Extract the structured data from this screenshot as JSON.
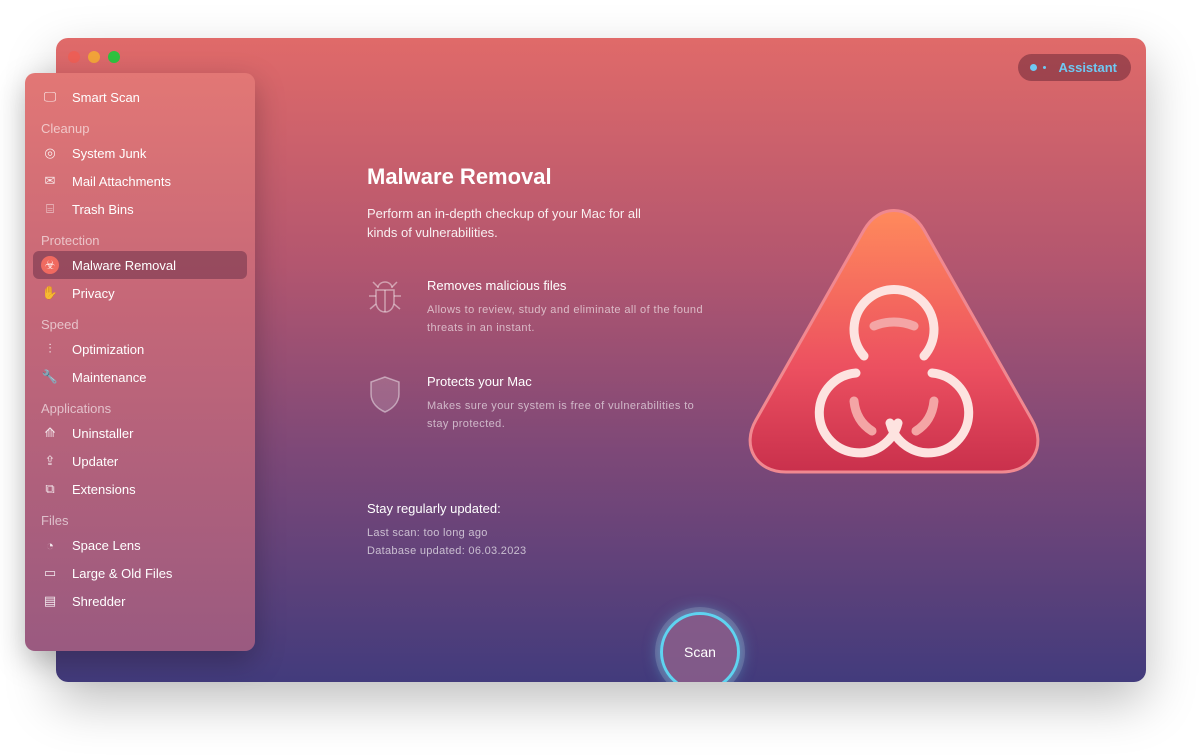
{
  "window": {
    "controls": [
      {
        "name": "close",
        "color": "#ed5f57"
      },
      {
        "name": "minimize",
        "color": "#f2a33a"
      },
      {
        "name": "zoom",
        "color": "#2ec23f"
      }
    ]
  },
  "assistant": {
    "label": "Assistant",
    "color": "#6fc8f2"
  },
  "sidebar": {
    "smart_scan": {
      "label": "Smart Scan",
      "icon": "monitor-icon"
    },
    "sections": [
      {
        "title": "Cleanup",
        "items": [
          {
            "label": "System Junk",
            "icon": "junk-icon"
          },
          {
            "label": "Mail Attachments",
            "icon": "mail-icon"
          },
          {
            "label": "Trash Bins",
            "icon": "trash-icon"
          }
        ]
      },
      {
        "title": "Protection",
        "items": [
          {
            "label": "Malware Removal",
            "icon": "biohazard-icon",
            "active": true
          },
          {
            "label": "Privacy",
            "icon": "hand-icon"
          }
        ]
      },
      {
        "title": "Speed",
        "items": [
          {
            "label": "Optimization",
            "icon": "sliders-icon"
          },
          {
            "label": "Maintenance",
            "icon": "wrench-icon"
          }
        ]
      },
      {
        "title": "Applications",
        "items": [
          {
            "label": "Uninstaller",
            "icon": "uninstaller-icon"
          },
          {
            "label": "Updater",
            "icon": "updater-icon"
          },
          {
            "label": "Extensions",
            "icon": "extensions-icon"
          }
        ]
      },
      {
        "title": "Files",
        "items": [
          {
            "label": "Space Lens",
            "icon": "lens-icon"
          },
          {
            "label": "Large & Old Files",
            "icon": "folder-icon"
          },
          {
            "label": "Shredder",
            "icon": "shredder-icon"
          }
        ]
      }
    ]
  },
  "main": {
    "title": "Malware Removal",
    "description": "Perform an in-depth checkup of your Mac for all kinds of vulnerabilities.",
    "features": [
      {
        "title": "Removes malicious files",
        "text": "Allows to review, study and eliminate all of the found threats in an instant.",
        "icon": "bug-icon"
      },
      {
        "title": "Protects your Mac",
        "text": "Makes sure your system is free of vulnerabilities to stay protected.",
        "icon": "shield-icon"
      }
    ],
    "update": {
      "title": "Stay regularly updated:",
      "last_scan": "Last scan: too long ago",
      "database": "Database updated: 06.03.2023"
    }
  },
  "scan_button": "Scan"
}
